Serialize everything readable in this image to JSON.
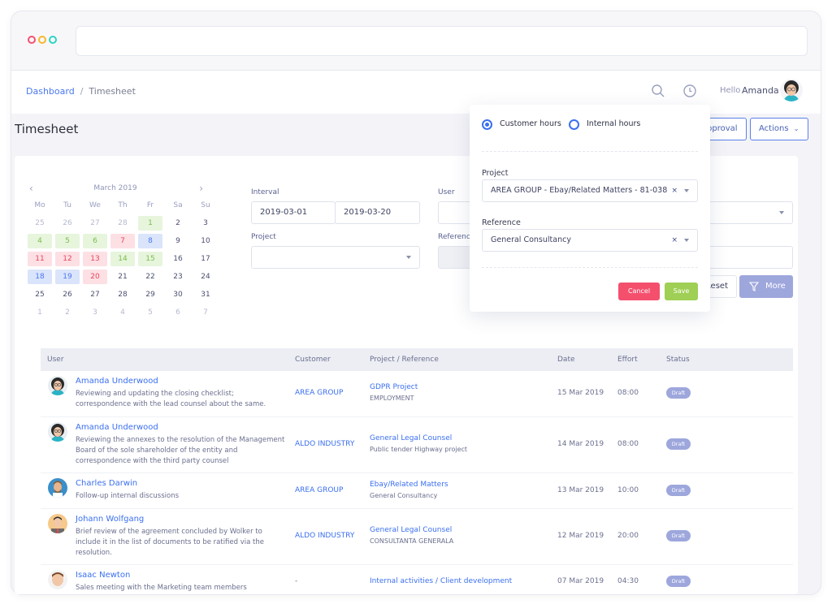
{
  "browser": {
    "dot_colors": [
      "#f4506e",
      "#f7b82a",
      "#2dd4c4"
    ],
    "url": ""
  },
  "breadcrumb": {
    "home": "Dashboard",
    "separator": "/",
    "current": "Timesheet"
  },
  "header": {
    "greeting": "Hello",
    "user_name": "Amanda",
    "icons": [
      "search-icon",
      "clock-icon"
    ]
  },
  "page": {
    "title": "Timesheet",
    "buttons": {
      "approval": "pproval",
      "actions": "Actions"
    }
  },
  "calendar": {
    "month_label": "March 2019",
    "days_of_week": [
      "Mo",
      "Tu",
      "We",
      "Th",
      "Fr",
      "Sa",
      "Su"
    ],
    "days": [
      {
        "d": "25",
        "s": "muted"
      },
      {
        "d": "26",
        "s": "muted"
      },
      {
        "d": "27",
        "s": "muted"
      },
      {
        "d": "28",
        "s": "muted"
      },
      {
        "d": "1",
        "s": "green"
      },
      {
        "d": "2",
        "s": ""
      },
      {
        "d": "3",
        "s": ""
      },
      {
        "d": "4",
        "s": "green"
      },
      {
        "d": "5",
        "s": "green"
      },
      {
        "d": "6",
        "s": "green"
      },
      {
        "d": "7",
        "s": "red"
      },
      {
        "d": "8",
        "s": "blue"
      },
      {
        "d": "9",
        "s": ""
      },
      {
        "d": "10",
        "s": ""
      },
      {
        "d": "11",
        "s": "red"
      },
      {
        "d": "12",
        "s": "red"
      },
      {
        "d": "13",
        "s": "red"
      },
      {
        "d": "14",
        "s": "green"
      },
      {
        "d": "15",
        "s": "green"
      },
      {
        "d": "16",
        "s": ""
      },
      {
        "d": "17",
        "s": ""
      },
      {
        "d": "18",
        "s": "blue"
      },
      {
        "d": "19",
        "s": "blue"
      },
      {
        "d": "20",
        "s": "red"
      },
      {
        "d": "21",
        "s": ""
      },
      {
        "d": "22",
        "s": ""
      },
      {
        "d": "23",
        "s": ""
      },
      {
        "d": "24",
        "s": ""
      },
      {
        "d": "25",
        "s": ""
      },
      {
        "d": "26",
        "s": ""
      },
      {
        "d": "27",
        "s": ""
      },
      {
        "d": "28",
        "s": ""
      },
      {
        "d": "29",
        "s": ""
      },
      {
        "d": "30",
        "s": ""
      },
      {
        "d": "31",
        "s": ""
      },
      {
        "d": "1",
        "s": "muted"
      },
      {
        "d": "2",
        "s": "muted"
      },
      {
        "d": "3",
        "s": "muted"
      },
      {
        "d": "4",
        "s": "muted"
      },
      {
        "d": "5",
        "s": "muted"
      },
      {
        "d": "6",
        "s": "muted"
      },
      {
        "d": "7",
        "s": "muted"
      }
    ]
  },
  "filters": {
    "interval_label": "Interval",
    "interval_from": "2019-03-01",
    "interval_to": "2019-03-20",
    "project_label": "Project",
    "project_value": "",
    "user_label": "User",
    "reference_label": "Referenc",
    "reset_label": "Reset",
    "more_label": "More"
  },
  "popover": {
    "radio_customer": "Customer hours",
    "radio_internal": "Internal hours",
    "selected": "customer",
    "project_label": "Project",
    "project_value": "AREA GROUP - Ebay/Related Matters - 81-038",
    "reference_label": "Reference",
    "reference_value": "General Consultancy",
    "clear_glyph": "×",
    "cancel_label": "Cancel",
    "save_label": "Save"
  },
  "table": {
    "headers": {
      "user": "User",
      "customer": "Customer",
      "project": "Project / Reference",
      "date": "Date",
      "effort": "Effort",
      "status": "Status"
    },
    "rows": [
      {
        "name": "Amanda Underwood",
        "desc": "Reviewing and updating the closing checklist; correspondence with the lead counsel about the same.",
        "customer": "AREA GROUP",
        "project": "GDPR Project",
        "reference": "EMPLOYMENT",
        "date": "15 Mar 2019",
        "effort": "08:00",
        "status": "Draft"
      },
      {
        "name": "Amanda Underwood",
        "desc": "Reviewing the annexes to the resolution of the Management Board of the sole shareholder of the entity and correspondence with the third party counsel",
        "customer": "ALDO INDUSTRY",
        "project": "General Legal Counsel",
        "reference": "Public tender Highway project",
        "date": "14 Mar 2019",
        "effort": "08:00",
        "status": "Draft"
      },
      {
        "name": "Charles Darwin",
        "desc": "Follow-up internal discussions",
        "customer": "AREA GROUP",
        "project": "Ebay/Related Matters",
        "reference": "General Consultancy",
        "date": "13 Mar 2019",
        "effort": "10:00",
        "status": "Draft"
      },
      {
        "name": "Johann Wolfgang",
        "desc": "Brief review of the agreement concluded by Wolker to include it in the list of documents to be ratified via the resolution.",
        "customer": "ALDO INDUSTRY",
        "project": "General Legal Counsel",
        "reference": "CONSULTANTA GENERALA",
        "date": "12 Mar 2019",
        "effort": "20:00",
        "status": "Draft"
      },
      {
        "name": "Isaac Newton",
        "desc": "Sales meeting with the Marketing team members",
        "customer": "-",
        "project": "Internal activities / Client development",
        "reference": "",
        "date": "07 Mar 2019",
        "effort": "04:30",
        "status": "Draft"
      }
    ]
  },
  "colors": {
    "accent": "#3a6ff0",
    "badge": "#9ea7dc",
    "cancel": "#f4506e",
    "save": "#9fcf55"
  }
}
